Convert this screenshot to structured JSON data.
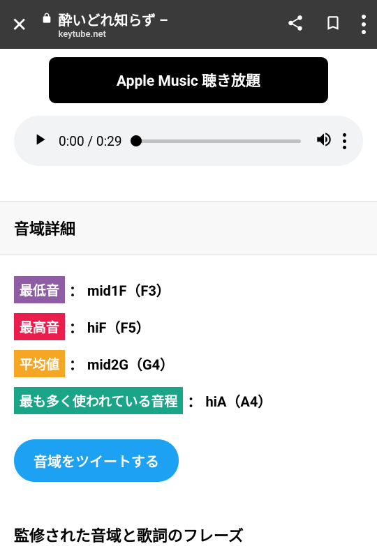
{
  "browser": {
    "title": "酔いどれ知らず  –",
    "url": "keytube.net"
  },
  "apple_music_label": "Apple Music 聴き放題",
  "player": {
    "current_time": "0:00",
    "duration": "0:29"
  },
  "section_title": "音域詳細",
  "ranges": {
    "lowest": {
      "label": "最低音",
      "value": "mid1F（F3）"
    },
    "highest": {
      "label": "最高音",
      "value": "hiF（F5）"
    },
    "average": {
      "label": "平均値",
      "value": "mid2G（G4）"
    },
    "most_used": {
      "label": "最も多く使われている音程",
      "value": "hiA（A4）"
    }
  },
  "separator": "：",
  "tweet_label": "音域をツイートする",
  "bottom_heading": "監修された音域と歌詞のフレーズ"
}
